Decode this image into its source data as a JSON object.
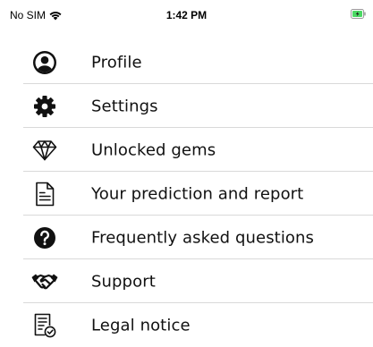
{
  "status_bar": {
    "carrier": "No SIM",
    "time": "1:42 PM",
    "battery_color": "#4cd964"
  },
  "menu": {
    "items": [
      {
        "label": "Profile",
        "icon": "profile-icon"
      },
      {
        "label": "Settings",
        "icon": "gear-icon"
      },
      {
        "label": "Unlocked gems",
        "icon": "gem-icon"
      },
      {
        "label": "Your prediction and report",
        "icon": "document-icon"
      },
      {
        "label": "Frequently asked questions",
        "icon": "question-icon"
      },
      {
        "label": "Support",
        "icon": "handshake-icon"
      },
      {
        "label": "Legal notice",
        "icon": "legal-document-icon"
      }
    ]
  }
}
